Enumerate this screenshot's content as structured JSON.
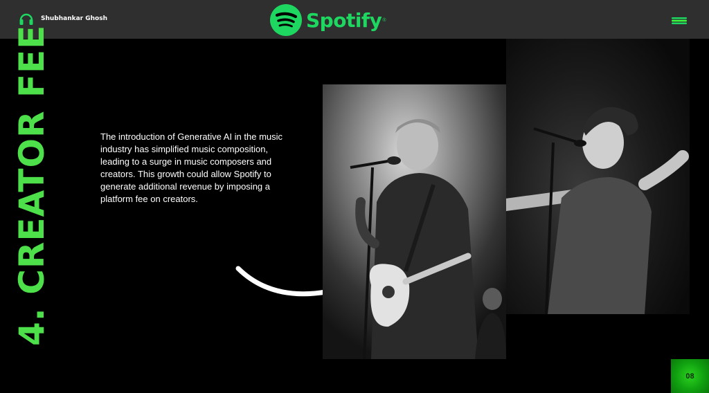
{
  "header": {
    "author_name": "Shubhankar Ghosh",
    "logo_text": "Spotify",
    "logo_mark": "®",
    "icons": [
      "headphones-icon",
      "spotify-logo-icon",
      "menu-icon"
    ]
  },
  "slide": {
    "title": "4. CREATOR FEE",
    "body": "The introduction of Generative AI in the music industry has simplified music composition, leading to a surge in music composers and creators. This growth could allow Spotify to generate additional revenue by imposing a platform fee on creators.",
    "page_number": "08"
  },
  "colors": {
    "accent": "#1ed760",
    "title_green": "#4ee04a",
    "header_bg": "#2f2f2f",
    "background": "#000000"
  }
}
